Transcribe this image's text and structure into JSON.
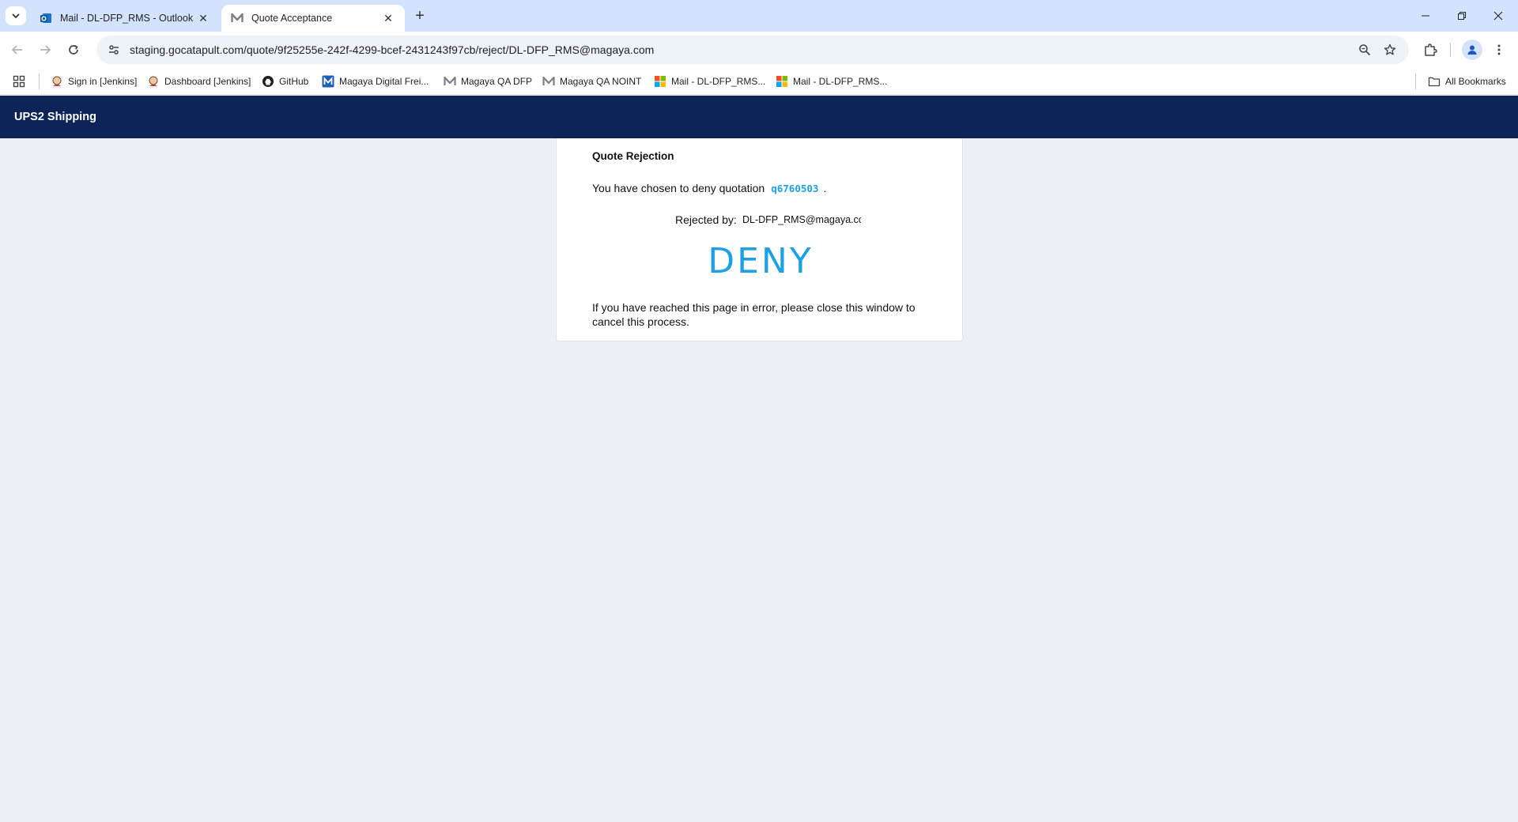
{
  "browser": {
    "tabs": [
      {
        "title": "Mail - DL-DFP_RMS - Outlook",
        "active": false
      },
      {
        "title": "Quote Acceptance",
        "active": true
      }
    ],
    "url": "staging.gocatapult.com/quote/9f25255e-242f-4299-bcef-2431243f97cb/reject/DL-DFP_RMS@magaya.com",
    "bookmarks": [
      {
        "label": "Sign in [Jenkins]",
        "icon": "jenkins-icon"
      },
      {
        "label": "Dashboard [Jenkins]",
        "icon": "jenkins-icon"
      },
      {
        "label": "GitHub",
        "icon": "github-icon"
      },
      {
        "label": "Magaya Digital Frei...",
        "icon": "magaya-icon"
      },
      {
        "label": "Magaya QA DFP",
        "icon": "magaya-icon"
      },
      {
        "label": "Magaya QA NOINT",
        "icon": "magaya-icon"
      },
      {
        "label": "Mail - DL-DFP_RMS...",
        "icon": "microsoft-icon"
      },
      {
        "label": "Mail - DL-DFP_RMS...",
        "icon": "microsoft-icon"
      }
    ],
    "all_bookmarks": "All Bookmarks"
  },
  "app": {
    "brand": "UPS2 Shipping"
  },
  "card": {
    "heading": "Quote Rejection",
    "intro": "You have chosen to deny quotation",
    "quote_number": "q6760503",
    "period": ".",
    "rejected_by_label": "Rejected by:",
    "rejected_by_value": "DL-DFP_RMS@magaya.com",
    "deny_label": "DENY",
    "note": "If you have reached this page in error, please close this window to cancel this process."
  },
  "colors": {
    "accent": "#1ea0e6",
    "appbar": "#0c2457",
    "page_bg": "#eceff4"
  }
}
